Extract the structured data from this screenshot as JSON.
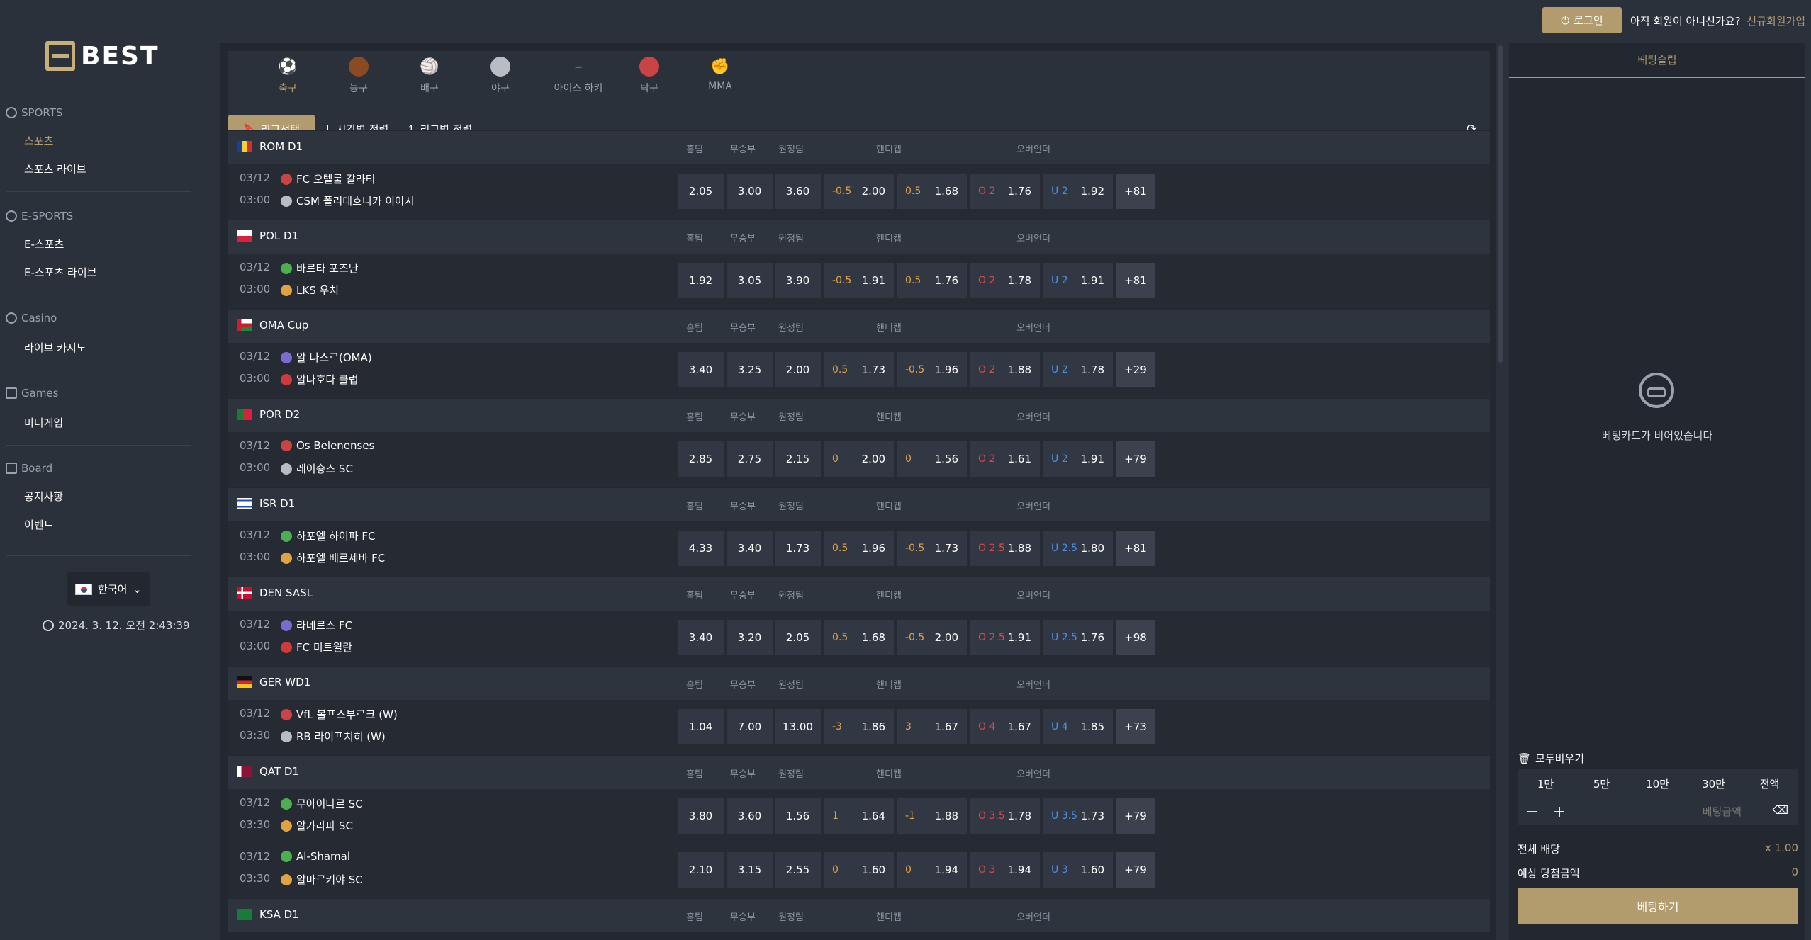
{
  "header": {
    "login_label": "로그인",
    "not_member_text": "아직 회원이 아니신가요?",
    "signup_label": "신규회원가입",
    "power_icon": "power-icon"
  },
  "brand": {
    "logo_text": "BEST",
    "accent": "#b29b6c"
  },
  "sidebar": {
    "sections": [
      {
        "title": "SPORTS",
        "icon": "gear-icon",
        "items": [
          "스포츠",
          "스포츠 라이브"
        ]
      },
      {
        "title": "E-SPORTS",
        "icon": "gear-icon",
        "items": [
          "E-스포츠",
          "E-스포츠 라이브"
        ]
      },
      {
        "title": "Casino",
        "icon": "spade-icon",
        "items": [
          "라이브 카지노"
        ]
      },
      {
        "title": "Games",
        "icon": "gamepad-icon",
        "items": [
          "미니게임"
        ]
      },
      {
        "title": "Board",
        "icon": "board-icon",
        "items": [
          "공지사항",
          "이벤트"
        ]
      }
    ],
    "language": "한국어",
    "datetime": "2024. 3. 12. 오전 2:43:39"
  },
  "sports_tabs": [
    "축구",
    "농구",
    "배구",
    "야구",
    "아이스 하키",
    "탁구",
    "MMA"
  ],
  "filters": {
    "league_select": "리그선택",
    "time_sort": "시간별 정렬",
    "league_sort": "리그별 정렬"
  },
  "columns": {
    "home": "홈팀",
    "draw": "무승부",
    "away": "원정팀",
    "handicap": "핸디캡",
    "overunder": "오버언더"
  },
  "leagues": [
    {
      "name": "ROM D1",
      "flag": "ro",
      "matches": [
        {
          "date": "03/12",
          "time": "03:00",
          "home": "FC 오텔룰 갈라티",
          "away": "CSM 폴리테흐니카 이아시",
          "h": "2.05",
          "d": "3.00",
          "a": "3.60",
          "hc1": "-0.5",
          "hc1v": "2.00",
          "hc2": "0.5",
          "hc2v": "1.68",
          "o": "O 2",
          "ov": "1.76",
          "u": "U 2",
          "uv": "1.92",
          "more": "+81"
        }
      ]
    },
    {
      "name": "POL D1",
      "flag": "pl",
      "matches": [
        {
          "date": "03/12",
          "time": "03:00",
          "home": "바르타 포즈난",
          "away": "LKS 우치",
          "h": "1.92",
          "d": "3.05",
          "a": "3.90",
          "hc1": "-0.5",
          "hc1v": "1.91",
          "hc2": "0.5",
          "hc2v": "1.76",
          "o": "O 2",
          "ov": "1.78",
          "u": "U 2",
          "uv": "1.91",
          "more": "+81"
        }
      ]
    },
    {
      "name": "OMA Cup",
      "flag": "om",
      "matches": [
        {
          "date": "03/12",
          "time": "03:00",
          "home": "알 나스르(OMA)",
          "away": "알나호다 클럽",
          "h": "3.40",
          "d": "3.25",
          "a": "2.00",
          "hc1": "0.5",
          "hc1v": "1.73",
          "hc2": "-0.5",
          "hc2v": "1.96",
          "o": "O 2",
          "ov": "1.88",
          "u": "U 2",
          "uv": "1.78",
          "more": "+29"
        }
      ]
    },
    {
      "name": "POR D2",
      "flag": "pt",
      "matches": [
        {
          "date": "03/12",
          "time": "03:00",
          "home": "Os Belenenses",
          "away": "레이숑스 SC",
          "h": "2.85",
          "d": "2.75",
          "a": "2.15",
          "hc1": "0",
          "hc1v": "2.00",
          "hc2": "0",
          "hc2v": "1.56",
          "o": "O 2",
          "ov": "1.61",
          "u": "U 2",
          "uv": "1.91",
          "more": "+79"
        }
      ]
    },
    {
      "name": "ISR D1",
      "flag": "il",
      "matches": [
        {
          "date": "03/12",
          "time": "03:00",
          "home": "하포엘 하이파 FC",
          "away": "하포엘 베르세바 FC",
          "h": "4.33",
          "d": "3.40",
          "a": "1.73",
          "hc1": "0.5",
          "hc1v": "1.96",
          "hc2": "-0.5",
          "hc2v": "1.73",
          "o": "O 2.5",
          "ov": "1.88",
          "u": "U 2.5",
          "uv": "1.80",
          "more": "+81"
        }
      ]
    },
    {
      "name": "DEN SASL",
      "flag": "dk",
      "matches": [
        {
          "date": "03/12",
          "time": "03:00",
          "home": "라네르스 FC",
          "away": "FC 미트윌란",
          "h": "3.40",
          "d": "3.20",
          "a": "2.05",
          "hc1": "0.5",
          "hc1v": "1.68",
          "hc2": "-0.5",
          "hc2v": "2.00",
          "o": "O 2.5",
          "ov": "1.91",
          "u": "U 2.5",
          "uv": "1.76",
          "more": "+98"
        }
      ]
    },
    {
      "name": "GER WD1",
      "flag": "de",
      "matches": [
        {
          "date": "03/12",
          "time": "03:30",
          "home": "VfL 볼프스부르크 (W)",
          "away": "RB 라이프치히 (W)",
          "h": "1.04",
          "d": "7.00",
          "a": "13.00",
          "hc1": "-3",
          "hc1v": "1.86",
          "hc2": "3",
          "hc2v": "1.67",
          "o": "O 4",
          "ov": "1.67",
          "u": "U 4",
          "uv": "1.85",
          "more": "+73"
        }
      ]
    },
    {
      "name": "QAT D1",
      "flag": "qa",
      "matches": [
        {
          "date": "03/12",
          "time": "03:30",
          "home": "무아이다르 SC",
          "away": "알가라파 SC",
          "h": "3.80",
          "d": "3.60",
          "a": "1.56",
          "hc1": "1",
          "hc1v": "1.64",
          "hc2": "-1",
          "hc2v": "1.88",
          "o": "O 3.5",
          "ov": "1.78",
          "u": "U 3.5",
          "uv": "1.73",
          "more": "+79"
        },
        {
          "date": "03/12",
          "time": "03:30",
          "home": "Al-Shamal",
          "away": "알마르키야 SC",
          "h": "2.10",
          "d": "3.15",
          "a": "2.55",
          "hc1": "0",
          "hc1v": "1.60",
          "hc2": "0",
          "hc2v": "1.94",
          "o": "O 3",
          "ov": "1.94",
          "u": "U 3",
          "uv": "1.60",
          "more": "+79"
        }
      ]
    },
    {
      "name": "KSA D1",
      "flag": "sa",
      "matches": []
    }
  ],
  "betslip": {
    "title": "베팅슬립",
    "empty_text": "베팅카트가 비어있습니다",
    "clear_all": "모두비우기",
    "amounts": [
      "1만",
      "5만",
      "10만",
      "30만",
      "전액"
    ],
    "stake_placeholder": "베팅금액",
    "total_odds_label": "전체 배당",
    "total_odds_value": "x 1.00",
    "expected_win_label": "예상 당첨금액",
    "expected_win_value": "0",
    "bet_button": "베팅하기"
  }
}
